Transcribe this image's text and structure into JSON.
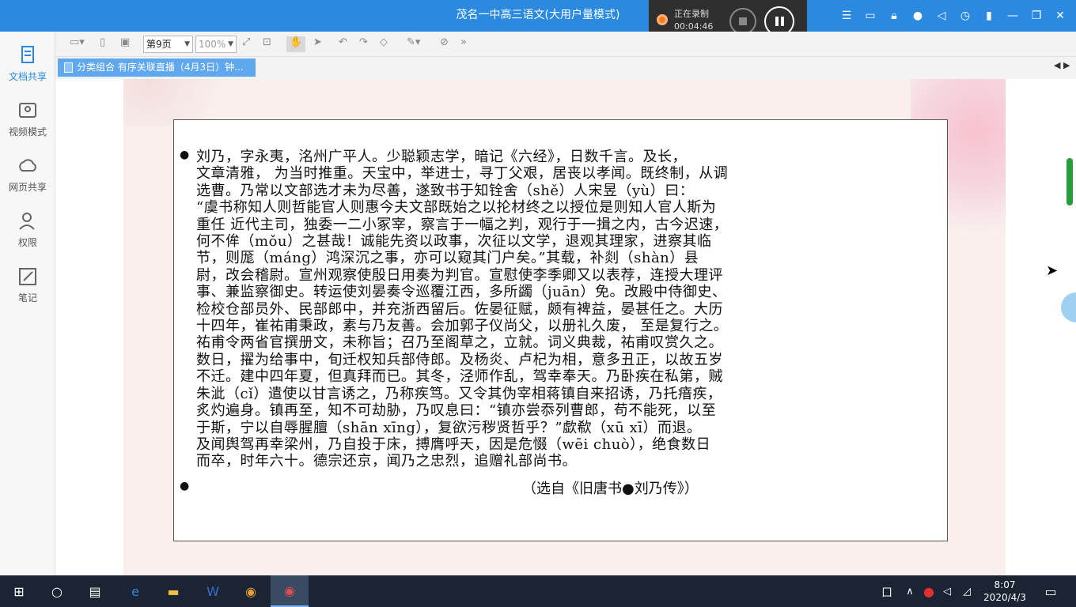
{
  "window": {
    "title": "茂名一中高三语文(大用户量模式)"
  },
  "recorder": {
    "status": "正在录制",
    "time": "00:04:46"
  },
  "sidebar": {
    "items": [
      {
        "label": "文档共享",
        "icon": "document-share-icon",
        "active": true
      },
      {
        "label": "视频模式",
        "icon": "video-mode-icon",
        "active": false
      },
      {
        "label": "网页共享",
        "icon": "web-share-icon",
        "active": false
      },
      {
        "label": "权限",
        "icon": "permission-icon",
        "active": false
      },
      {
        "label": "笔记",
        "icon": "note-icon",
        "active": false
      }
    ]
  },
  "toolbar": {
    "page": "第9页",
    "zoom": "100%"
  },
  "tab": {
    "label": "分类组合 有序关联直播（4月3日）钟..."
  },
  "slide": {
    "lines": [
      "刘乃，字永夷，洺州广平人。少聪颖志学，暗记《六经》，日数千言。及长，",
      "文章清雅， 为当时推重。天宝中，举进士，寻丁父艰，居丧以孝闻。既终制，从调",
      "选曹。乃常以文部选才未为尽善，遂致书于知铨舍（shě）人宋昱（yù）曰：",
      "“虞书称知人则哲能官人则惠今夫文部既始之以抡材终之以授位是则知人官人斯为",
      "重任 近代主司，独委一二小冢宰，察言于一幅之判，观行于一揖之内，古今迟速，",
      "何不侔（mǒu）之甚哉！诚能先资以政事，次征以文学，退观其理家，进察其临",
      "节，则厖（máng）鸿深沉之事，亦可以窥其门户矣。”其载，补剡（shàn）县",
      "尉，改会稽尉。宣州观察使殷日用奏为判官。宣慰使李季卿又以表荐，连授大理评",
      "事、兼监察御史。转运使刘晏奏令巡覆江西，多所蠲（juān）免。改殿中侍御史、",
      "检校仓部员外、民部郎中，并充浙西留后。佐晏征赋，颇有裨益，晏甚任之。大历",
      "十四年，崔祐甫秉政，素与乃友善。会加郭子仪尚父，以册礼久废， 至是复行之。",
      "祐甫令两省官撰册文，未称旨；召乃至阁草之，立就。词义典裁，祐甫叹赏久之。",
      "数日，擢为给事中，旬迁权知兵部侍郎。及杨炎、卢杞为相，意多丑正，以故五岁",
      "不迁。建中四年夏，但真拜而已。其冬，泾师作乱，驾幸奉天。乃卧疾在私第，贼",
      "朱泚（cǐ）遣使以甘言诱之，乃称疾笃。又令其伪宰相蒋镇自来招诱，乃托瘖疾，",
      "炙灼遍身。镇再至，知不可劫胁，乃叹息曰：“镇亦尝忝列曹郎，苟不能死，以至",
      "于斯，宁以自辱腥膻（shān xīng），复欲污秽贤哲乎？”歔欷（xū xī）而退。",
      "及闻舆驾再幸梁州，乃自投于床，搏膺呼天，因是危惙（wēi chuò），绝食数日",
      "而卒，时年六十。德宗还京，闻乃之忠烈，追赠礼部尚书。"
    ],
    "source": "（选自《旧唐书●刘乃传》）"
  },
  "taskbar": {
    "time": "8:07",
    "date": "2020/4/3"
  },
  "colors": {
    "accent": "#2b8ae0",
    "annotation_red": "#e02020",
    "annotation_blue": "#1a3bd6"
  }
}
